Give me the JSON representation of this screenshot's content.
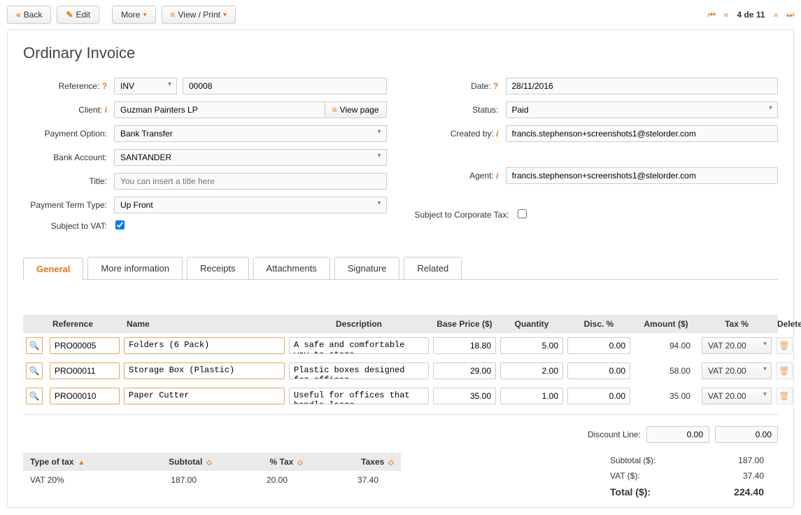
{
  "toolbar": {
    "back": "Back",
    "edit": "Edit",
    "more": "More",
    "viewprint": "View / Print"
  },
  "paginator": {
    "text": "4 de 11"
  },
  "page": {
    "title": "Ordinary Invoice"
  },
  "labels": {
    "reference": "Reference:",
    "client": "Client:",
    "payment_option": "Payment Option:",
    "bank_account": "Bank Account:",
    "title": "Title:",
    "payment_term_type": "Payment Term Type:",
    "subject_vat": "Subject to VAT:",
    "date": "Date:",
    "status": "Status:",
    "created_by": "Created by:",
    "agent": "Agent:",
    "subject_corp": "Subject to Corporate Tax:"
  },
  "fields": {
    "ref_prefix": "INV",
    "ref_number": "00008",
    "client": "Guzman Painters LP",
    "viewpage": "View page",
    "payment_option": "Bank Transfer",
    "bank_account": "SANTANDER",
    "title_placeholder": "You can insert a title here",
    "payment_term": "Up Front",
    "date": "28/11/2016",
    "status": "Paid",
    "created_by": "francis.stephenson+screenshots1@stelorder.com",
    "agent": "francis.stephenson+screenshots1@stelorder.com"
  },
  "tabs": {
    "general": "General",
    "more_info": "More information",
    "receipts": "Receipts",
    "attachments": "Attachments",
    "signature": "Signature",
    "related": "Related"
  },
  "item_head": {
    "reference": "Reference",
    "name": "Name",
    "description": "Description",
    "base_price": "Base Price ($)",
    "quantity": "Quantity",
    "disc": "Disc. %",
    "amount": "Amount ($)",
    "tax": "Tax %",
    "delete": "Delete"
  },
  "items": [
    {
      "ref": "PRO00005",
      "name": "Folders (6 Pack)",
      "desc": "A safe and comfortable way to store",
      "price": "18.80",
      "qty": "5.00",
      "disc": "0.00",
      "amount": "94.00",
      "tax": "VAT 20.00"
    },
    {
      "ref": "PRO00011",
      "name": "Storage Box (Plastic)",
      "desc": "Plastic boxes designed for offices,",
      "price": "29.00",
      "qty": "2.00",
      "disc": "0.00",
      "amount": "58.00",
      "tax": "VAT 20.00"
    },
    {
      "ref": "PRO00010",
      "name": "Paper Cutter",
      "desc": "Useful for offices that handle large",
      "price": "35.00",
      "qty": "1.00",
      "disc": "0.00",
      "amount": "35.00",
      "tax": "VAT 20.00"
    }
  ],
  "discount": {
    "label": "Discount Line:",
    "val1": "0.00",
    "val2": "0.00"
  },
  "tax_table": {
    "h1": "Type of tax",
    "h2": "Subtotal",
    "h3": "% Tax",
    "h4": "Taxes",
    "r1c1": "VAT 20%",
    "r1c2": "187.00",
    "r1c3": "20.00",
    "r1c4": "37.40"
  },
  "totals": {
    "subtotal_lbl": "Subtotal ($):",
    "subtotal_val": "187.00",
    "vat_lbl": "VAT ($):",
    "vat_val": "37.40",
    "total_lbl": "Total ($):",
    "total_val": "224.40"
  }
}
